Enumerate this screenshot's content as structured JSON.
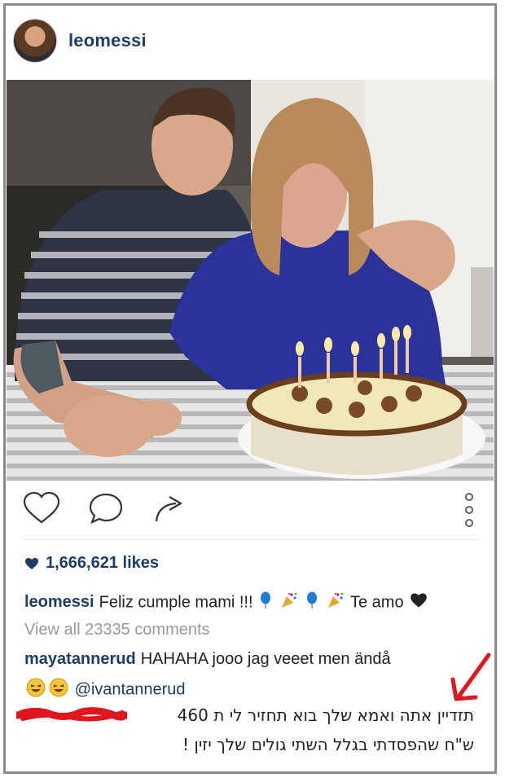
{
  "post": {
    "username": "leomessi",
    "likes": "1,666,621 likes",
    "caption": {
      "user": "leomessi",
      "text_before": "Feliz cumple mami !!!",
      "text_after": "Te amo"
    },
    "view_all": "View all 23335 comments",
    "comments": [
      {
        "user": "mayatannerud",
        "text": "HAHAHA jooo jag veeet men ändå",
        "mention": "@ivantannerud"
      }
    ],
    "hebrew_comment": {
      "line1": "תזדיין אתה ואמא שלך בוא תחזיר לי ת 460",
      "line2": "ש\"ח שהפסדתי בגלל השתי גולים שלך יזין !"
    }
  },
  "icons": {
    "like": "heart-outline-icon",
    "comment": "comment-bubble-icon",
    "share": "share-arrow-icon",
    "more": "vertical-dots-icon",
    "likes_heart": "filled-heart-icon"
  },
  "colors": {
    "link": "#1f3d63",
    "muted": "#9a9a9a",
    "annotation": "#e0161e"
  }
}
